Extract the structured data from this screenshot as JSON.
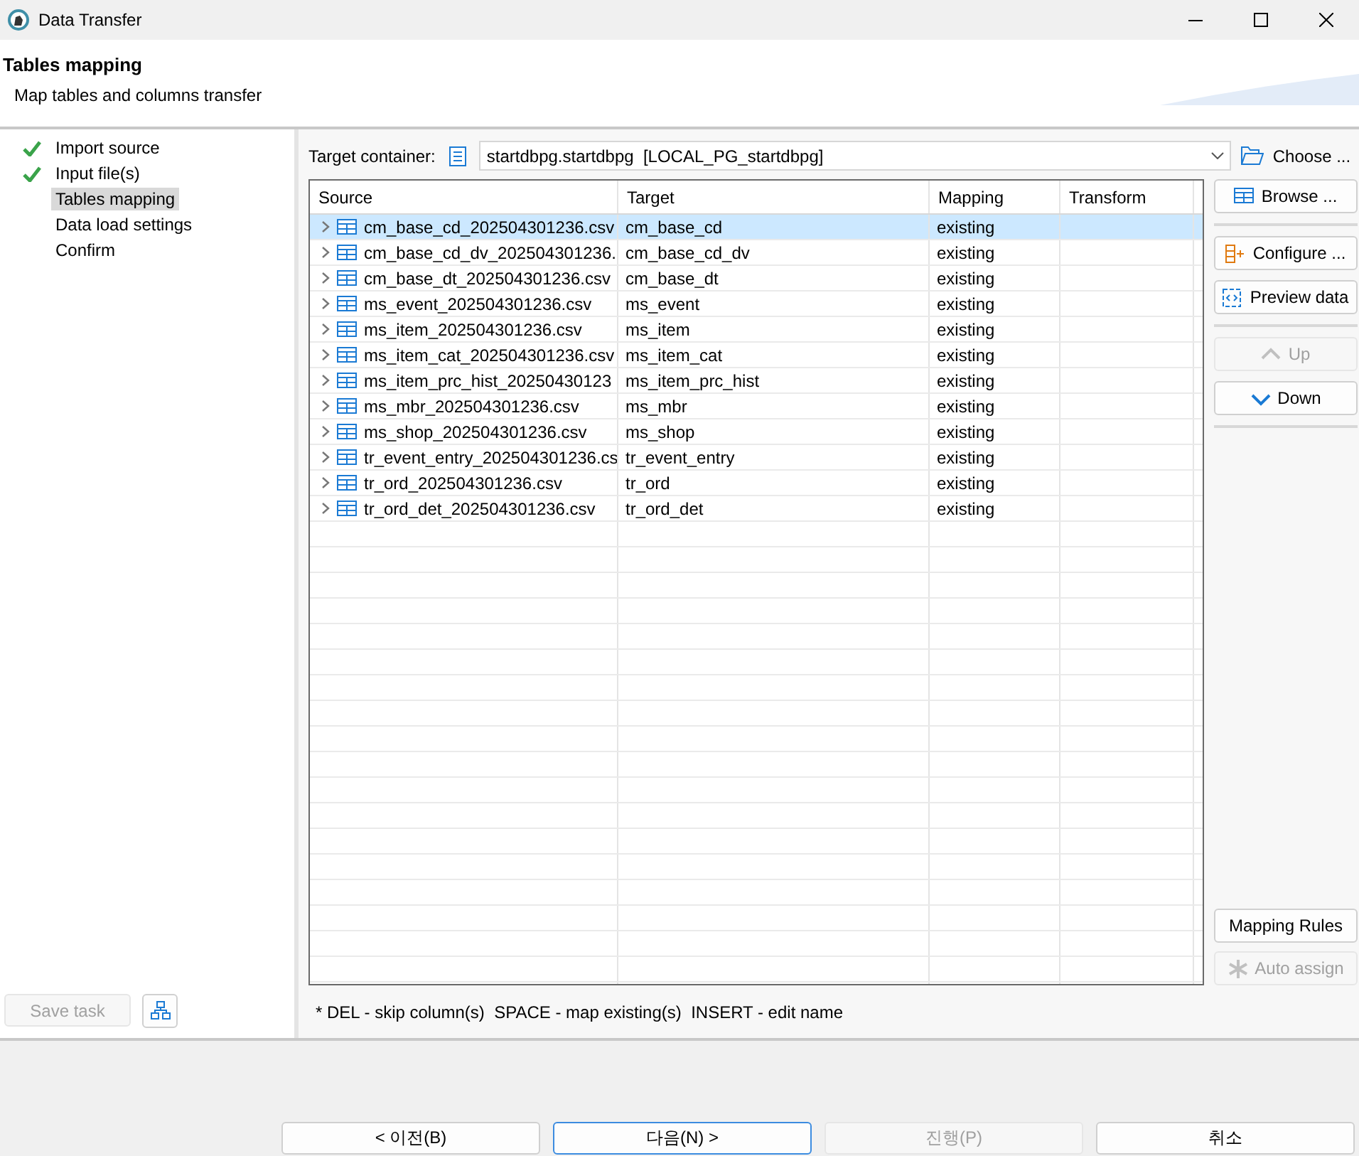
{
  "window": {
    "title": "Data Transfer"
  },
  "header": {
    "title": "Tables mapping",
    "subtitle": "Map tables and columns transfer"
  },
  "steps": [
    {
      "label": "Import source",
      "done": true,
      "selected": false
    },
    {
      "label": "Input file(s)",
      "done": true,
      "selected": false
    },
    {
      "label": "Tables mapping",
      "done": false,
      "selected": true
    },
    {
      "label": "Data load settings",
      "done": false,
      "selected": false
    },
    {
      "label": "Confirm",
      "done": false,
      "selected": false
    }
  ],
  "save_task": {
    "label": "Save task",
    "disabled": true
  },
  "target_container": {
    "label": "Target container:",
    "value": "startdbpg.startdbpg  [LOCAL_PG_startdbpg]",
    "choose": "Choose ..."
  },
  "table": {
    "columns": [
      "Source",
      "Target",
      "Mapping",
      "Transform"
    ],
    "rows": [
      {
        "source": "cm_base_cd_202504301236.csv",
        "target": "cm_base_cd",
        "mapping": "existing",
        "selected": true
      },
      {
        "source": "cm_base_cd_dv_202504301236.",
        "target": "cm_base_cd_dv",
        "mapping": "existing",
        "selected": false
      },
      {
        "source": "cm_base_dt_202504301236.csv",
        "target": "cm_base_dt",
        "mapping": "existing",
        "selected": false
      },
      {
        "source": "ms_event_202504301236.csv",
        "target": "ms_event",
        "mapping": "existing",
        "selected": false
      },
      {
        "source": "ms_item_202504301236.csv",
        "target": "ms_item",
        "mapping": "existing",
        "selected": false
      },
      {
        "source": "ms_item_cat_202504301236.csv",
        "target": "ms_item_cat",
        "mapping": "existing",
        "selected": false
      },
      {
        "source": "ms_item_prc_hist_20250430123",
        "target": "ms_item_prc_hist",
        "mapping": "existing",
        "selected": false
      },
      {
        "source": "ms_mbr_202504301236.csv",
        "target": "ms_mbr",
        "mapping": "existing",
        "selected": false
      },
      {
        "source": "ms_shop_202504301236.csv",
        "target": "ms_shop",
        "mapping": "existing",
        "selected": false
      },
      {
        "source": "tr_event_entry_202504301236.cs",
        "target": "tr_event_entry",
        "mapping": "existing",
        "selected": false
      },
      {
        "source": "tr_ord_202504301236.csv",
        "target": "tr_ord",
        "mapping": "existing",
        "selected": false
      },
      {
        "source": "tr_ord_det_202504301236.csv",
        "target": "tr_ord_det",
        "mapping": "existing",
        "selected": false
      }
    ]
  },
  "side_button_groups": [
    [
      {
        "label": "Browse ...",
        "kind": "browse",
        "disabled": false
      }
    ],
    [
      {
        "label": "Configure ...",
        "kind": "configure",
        "disabled": false
      },
      {
        "label": "Preview data",
        "kind": "preview",
        "disabled": false
      }
    ],
    [
      {
        "label": "Up",
        "kind": "up",
        "disabled": true
      },
      {
        "label": "Down",
        "kind": "down",
        "disabled": false
      }
    ]
  ],
  "rule_buttons": [
    {
      "label": "Mapping Rules",
      "kind": "text",
      "disabled": false
    },
    {
      "label": "Auto assign",
      "kind": "auto",
      "disabled": true
    }
  ],
  "hint": "* DEL - skip column(s)  SPACE - map existing(s)  INSERT - edit name",
  "wizard_buttons": [
    {
      "label": "< 이전(B)",
      "disabled": false,
      "default": false
    },
    {
      "label": "다음(N) >",
      "disabled": false,
      "default": true
    },
    {
      "label": "진행(P)",
      "disabled": true,
      "default": false
    },
    {
      "label": "취소",
      "disabled": false,
      "default": false
    }
  ]
}
